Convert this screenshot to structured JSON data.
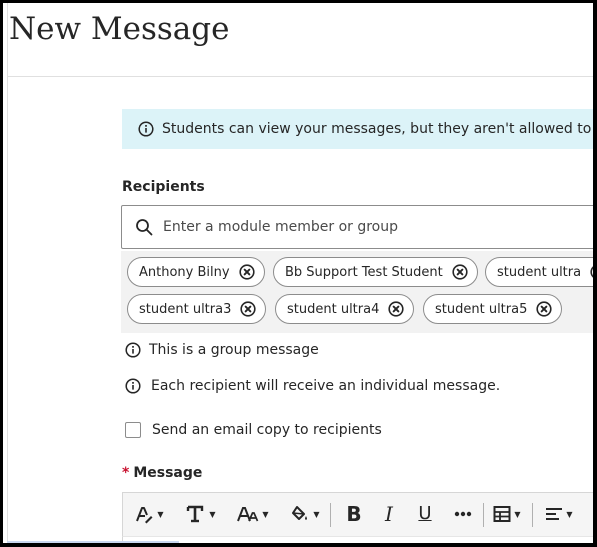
{
  "page": {
    "title": "New Message"
  },
  "info_banner": {
    "icon": "info-icon",
    "text": "Students can view your messages, but they aren't allowed to rep"
  },
  "recipients": {
    "label": "Recipients",
    "search_placeholder": "Enter a module member or group",
    "chips": [
      {
        "name": "Anthony Bilny"
      },
      {
        "name": "Bb Support Test Student"
      },
      {
        "name": "student ultra"
      },
      {
        "name": "student ultra3"
      },
      {
        "name": "student ultra4"
      },
      {
        "name": "student ultra5"
      }
    ]
  },
  "notes": {
    "group_message": "This is a group message",
    "individual": "Each recipient will receive an individual message."
  },
  "email_copy": {
    "label": "Send an email copy to recipients",
    "checked": false
  },
  "message": {
    "required_marker": "*",
    "label": "Message"
  },
  "toolbar": {
    "buttons": [
      {
        "icon": "text-style-icon",
        "has_menu": true
      },
      {
        "icon": "font-type-icon",
        "has_menu": true
      },
      {
        "icon": "font-size-icon",
        "has_menu": true
      },
      {
        "icon": "fill-color-icon",
        "has_menu": true
      },
      {
        "icon": "bold-icon",
        "glyph": "B"
      },
      {
        "icon": "italic-icon",
        "glyph": "I"
      },
      {
        "icon": "underline-icon",
        "glyph": "U"
      },
      {
        "icon": "more-icon"
      },
      {
        "icon": "table-icon",
        "has_menu": true
      },
      {
        "icon": "align-icon",
        "has_menu": true
      }
    ]
  },
  "colors": {
    "banner_bg": "#dcf3f8",
    "required": "#c8102e",
    "chip_area_bg": "#f2f2f2"
  }
}
